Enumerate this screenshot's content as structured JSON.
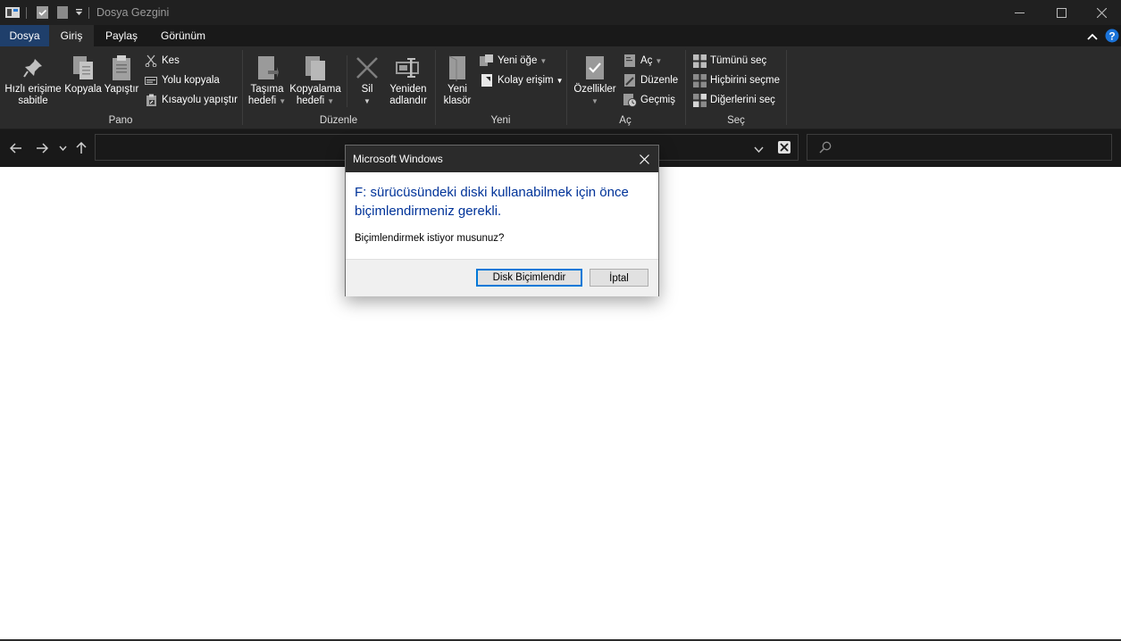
{
  "window": {
    "title": "Dosya Gezgini"
  },
  "tabs": [
    "Dosya",
    "Giriş",
    "Paylaş",
    "Görünüm"
  ],
  "ribbon": {
    "pano": {
      "label": "Pano",
      "pin_line1": "Hızlı erişime",
      "pin_line2": "sabitle",
      "copy": "Kopyala",
      "paste": "Yapıştır",
      "cut": "Kes",
      "copy_path": "Yolu kopyala",
      "paste_shortcut": "Kısayolu yapıştır"
    },
    "duzenle": {
      "label": "Düzenle",
      "move_line1": "Taşıma",
      "move_line2": "hedefi",
      "copyto_line1": "Kopyalama",
      "copyto_line2": "hedefi",
      "delete": "Sil",
      "rename_line1": "Yeniden",
      "rename_line2": "adlandır"
    },
    "yeni": {
      "label": "Yeni",
      "new_item": "Yeni öğe",
      "easy_access": "Kolay erişim",
      "newfolder_line1": "Yeni",
      "newfolder_line2": "klasör"
    },
    "ac": {
      "label": "Aç",
      "properties": "Özellikler",
      "open": "Aç",
      "edit": "Düzenle",
      "history": "Geçmiş"
    },
    "sec": {
      "label": "Seç",
      "select_all": "Tümünü seç",
      "select_none": "Hiçbirini seçme",
      "invert": "Diğerlerini seç"
    }
  },
  "dialog": {
    "title": "Microsoft Windows",
    "message": "F: sürücüsündeki diski kullanabilmek için önce biçimlendirmeniz gerekli.",
    "question": "Biçimlendirmek istiyor musunuz?",
    "format_button": "Disk Biçimlendir",
    "cancel_button": "İptal"
  }
}
